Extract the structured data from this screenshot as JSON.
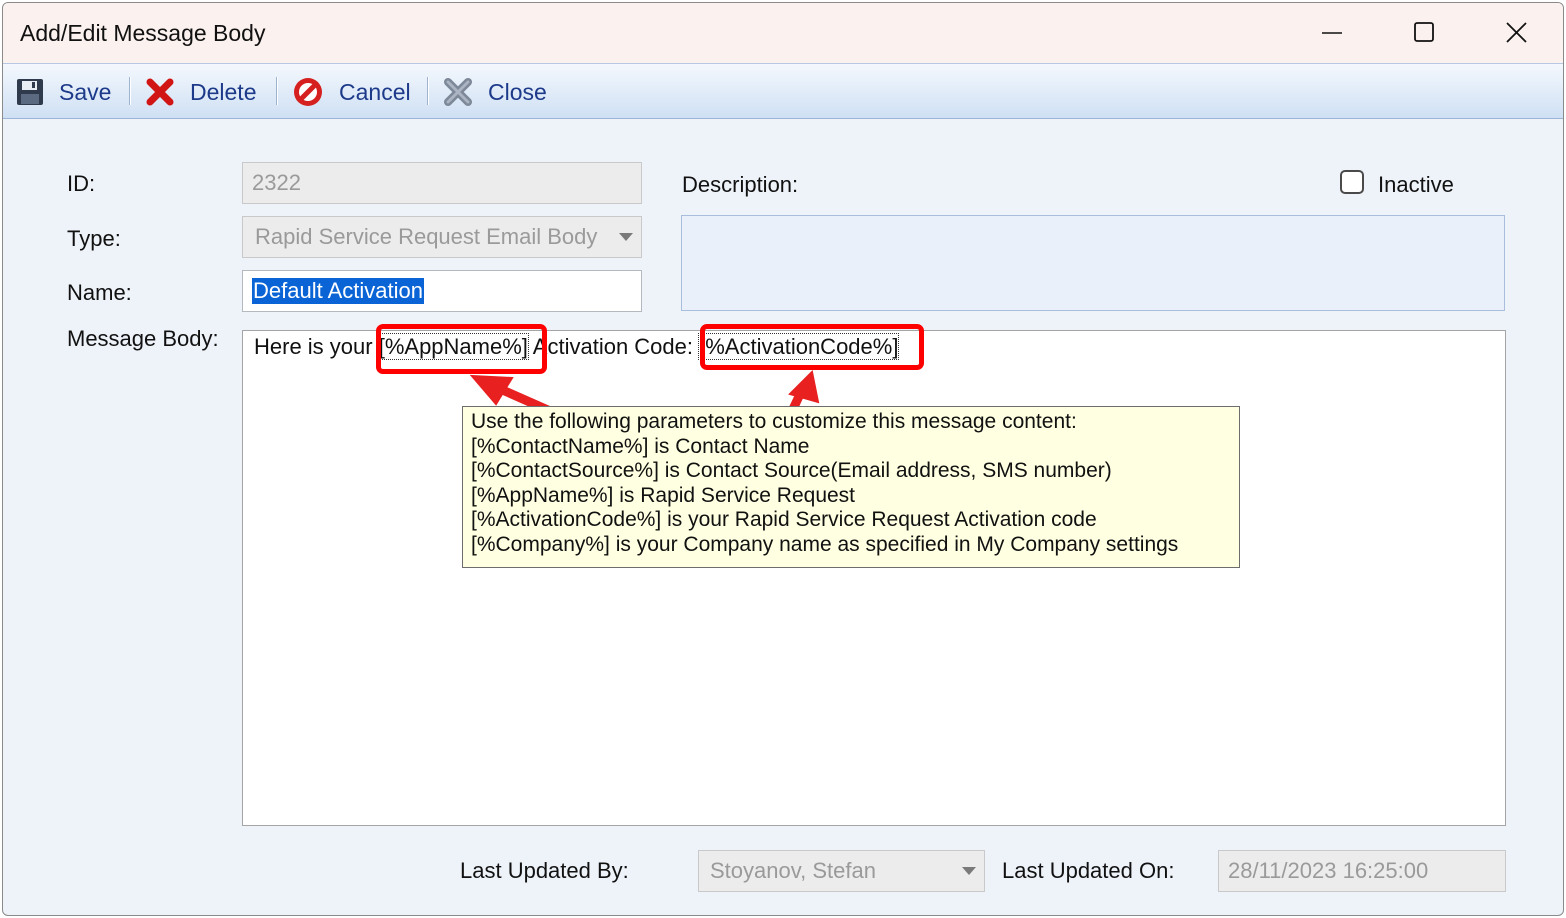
{
  "window": {
    "title": "Add/Edit Message Body"
  },
  "toolbar": {
    "save_label": "Save",
    "delete_label": "Delete",
    "cancel_label": "Cancel",
    "close_label": "Close"
  },
  "form": {
    "id_label": "ID:",
    "id_value": "2322",
    "type_label": "Type:",
    "type_value": "Rapid Service Request Email Body",
    "name_label": "Name:",
    "name_value": "Default Activation",
    "description_label": "Description:",
    "description_value": "",
    "inactive_label": "Inactive",
    "inactive_checked": false,
    "message_body_label": "Message Body:",
    "message_body": {
      "part1": "Here is your ",
      "token1": "[%AppName%]",
      "part2": " Activation Code: ",
      "token2": "[%ActivationCode%]"
    }
  },
  "tooltip": {
    "lines": [
      "Use the following parameters to customize this message content:",
      "[%ContactName%] is Contact Name",
      "[%ContactSource%] is Contact Source(Email address, SMS number)",
      "[%AppName%] is Rapid Service Request",
      "[%ActivationCode%] is your Rapid Service Request Activation code",
      "[%Company%] is your Company name as specified in My Company settings"
    ]
  },
  "footer": {
    "last_updated_by_label": "Last Updated By:",
    "last_updated_by_value": "Stoyanov, Stefan",
    "last_updated_on_label": "Last Updated On:",
    "last_updated_on_value": "28/11/2023 16:25:00"
  },
  "colors": {
    "annotation_red": "#ff0000",
    "tooltip_bg": "#ffffe1",
    "selection_blue": "#0a64d6",
    "toolbar_text": "#1d3a8a"
  }
}
